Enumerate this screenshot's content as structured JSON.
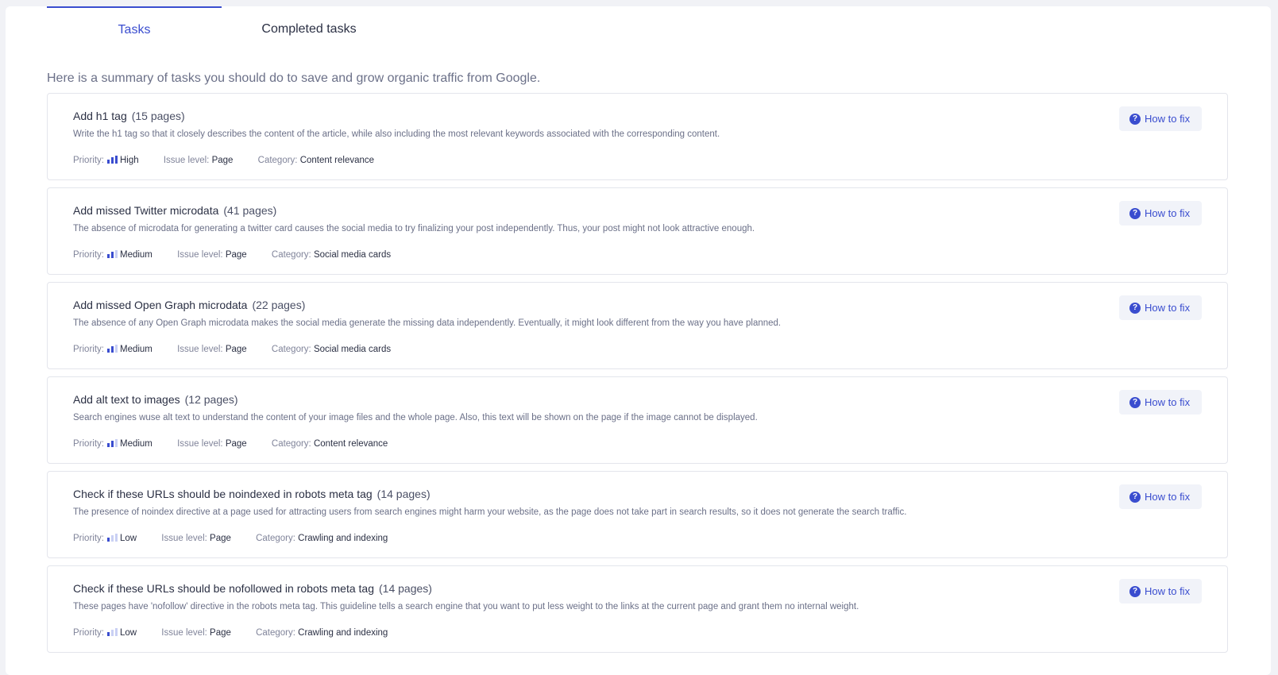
{
  "tabs": [
    {
      "label": "Tasks",
      "active": true
    },
    {
      "label": "Completed tasks",
      "active": false
    }
  ],
  "intro": "Here is a summary of tasks you should do to save and grow organic traffic from Google.",
  "labels": {
    "priority": "Priority:",
    "issue_level": "Issue level:",
    "category": "Category:",
    "how_to_fix": "How to fix",
    "help_icon": "?"
  },
  "tasks": [
    {
      "title": "Add h1 tag",
      "count": "(15 pages)",
      "description": "Write the h1 tag so that it closely describes the content of the article, while also including the most relevant keywords associated with the corresponding content.",
      "priority": "High",
      "priority_level": 3,
      "issue_level": "Page",
      "category": "Content relevance"
    },
    {
      "title": "Add missed Twitter microdata",
      "count": "(41 pages)",
      "description": "The absence of microdata for generating a twitter card causes the social media to try finalizing your post independently. Thus, your post might not look attractive enough.",
      "priority": "Medium",
      "priority_level": 2,
      "issue_level": "Page",
      "category": "Social media cards"
    },
    {
      "title": "Add missed Open Graph microdata",
      "count": "(22 pages)",
      "description": "The absence of any Open Graph microdata makes the social media generate the missing data independently. Eventually, it might look different from the way you have planned.",
      "priority": "Medium",
      "priority_level": 2,
      "issue_level": "Page",
      "category": "Social media cards"
    },
    {
      "title": "Add alt text to images",
      "count": "(12 pages)",
      "description": "Search engines wuse alt text to understand the content of your image files and the whole page. Also, this text will be shown on the page if the image cannot be displayed.",
      "priority": "Medium",
      "priority_level": 2,
      "issue_level": "Page",
      "category": "Content relevance"
    },
    {
      "title": "Check if these URLs should be noindexed in robots meta tag",
      "count": "(14 pages)",
      "description": "The presence of noindex directive at a page used for attracting users from search engines might harm your website, as the page does not take part in search results, so it does not generate the search traffic.",
      "priority": "Low",
      "priority_level": 1,
      "issue_level": "Page",
      "category": "Crawling and indexing"
    },
    {
      "title": "Check if these URLs should be nofollowed in robots meta tag",
      "count": "(14 pages)",
      "description": "These pages have 'nofollow' directive in the robots meta tag. This guideline tells a search engine that you want to put less weight to the links at the current page and grant them no internal weight.",
      "priority": "Low",
      "priority_level": 1,
      "issue_level": "Page",
      "category": "Crawling and indexing"
    }
  ]
}
